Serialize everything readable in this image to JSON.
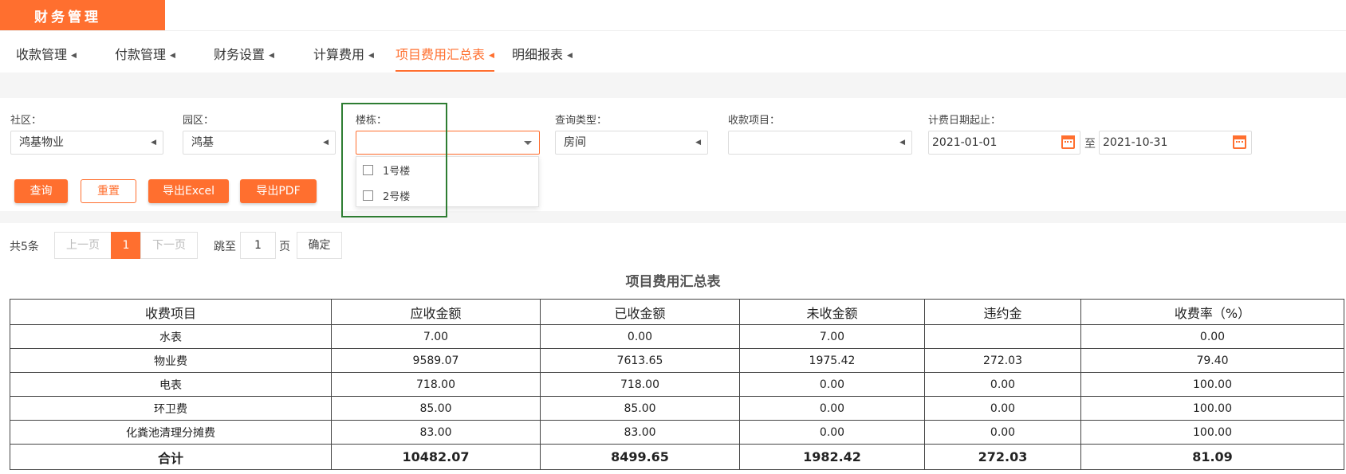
{
  "app": {
    "title": "财务管理"
  },
  "tabs": [
    {
      "label": "收款管理",
      "active": false
    },
    {
      "label": "付款管理",
      "active": false
    },
    {
      "label": "财务设置",
      "active": false
    },
    {
      "label": "计算费用",
      "active": false
    },
    {
      "label": "项目费用汇总表",
      "active": true
    },
    {
      "label": "明细报表",
      "active": false
    }
  ],
  "filters": {
    "community": {
      "label": "社区：",
      "value": "鸿基物业"
    },
    "park": {
      "label": "园区：",
      "value": "鸿基"
    },
    "building": {
      "label": "楼栋：",
      "value": ""
    },
    "query_type": {
      "label": "查询类型：",
      "value": "房间"
    },
    "charge_item": {
      "label": "收款项目：",
      "value": ""
    },
    "date_range": {
      "label": "计费日期起止：",
      "start": "2021-01-01",
      "separator": "至",
      "end": "2021-10-31"
    }
  },
  "building_dropdown": {
    "options": [
      {
        "label": "1号楼",
        "checked": false
      },
      {
        "label": "2号楼",
        "checked": false
      }
    ]
  },
  "buttons": {
    "query": "查询",
    "reset": "重置",
    "export_excel": "导出Excel",
    "export_pdf": "导出PDF"
  },
  "pagination": {
    "total": "共5条",
    "prev": "上一页",
    "current": "1",
    "next": "下一页",
    "goto_label": "跳至",
    "goto_value": "1",
    "page_unit": "页",
    "confirm": "确定"
  },
  "report": {
    "title": "项目费用汇总表",
    "columns": [
      "收费项目",
      "应收金额",
      "已收金额",
      "未收金额",
      "违约金",
      "收费率（%）"
    ],
    "rows": [
      [
        "水表",
        "7.00",
        "0.00",
        "7.00",
        "",
        "0.00"
      ],
      [
        "物业费",
        "9589.07",
        "7613.65",
        "1975.42",
        "272.03",
        "79.40"
      ],
      [
        "电表",
        "718.00",
        "718.00",
        "0.00",
        "0.00",
        "100.00"
      ],
      [
        "环卫费",
        "85.00",
        "85.00",
        "0.00",
        "0.00",
        "100.00"
      ],
      [
        "化粪池清理分摊费",
        "83.00",
        "83.00",
        "0.00",
        "0.00",
        "100.00"
      ]
    ],
    "total": [
      "合计",
      "10482.07",
      "8499.65",
      "1982.42",
      "272.03",
      "81.09"
    ]
  },
  "colors": {
    "accent": "#ff6f2f",
    "highlight_box": "#2e7d32"
  }
}
